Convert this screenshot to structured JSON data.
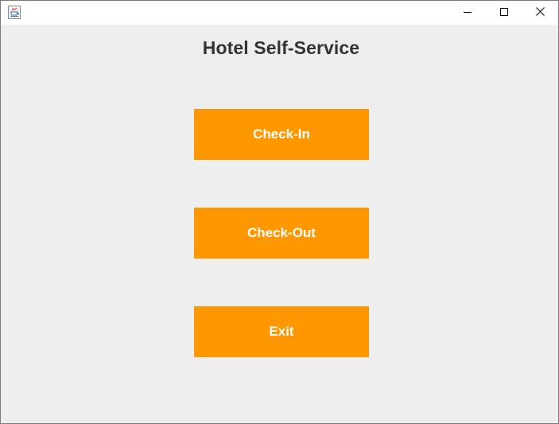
{
  "window": {
    "app_icon": "java-coffee-cup-icon",
    "controls": {
      "minimize_icon": "minimize-icon",
      "maximize_icon": "maximize-icon",
      "close_icon": "close-icon"
    }
  },
  "main": {
    "title": "Hotel Self-Service",
    "buttons": {
      "check_in": "Check-In",
      "check_out": "Check-Out",
      "exit": "Exit"
    }
  },
  "colors": {
    "accent": "#ff9800",
    "background": "#eeeeee",
    "title_text": "#333333",
    "button_text": "#ffffff"
  }
}
